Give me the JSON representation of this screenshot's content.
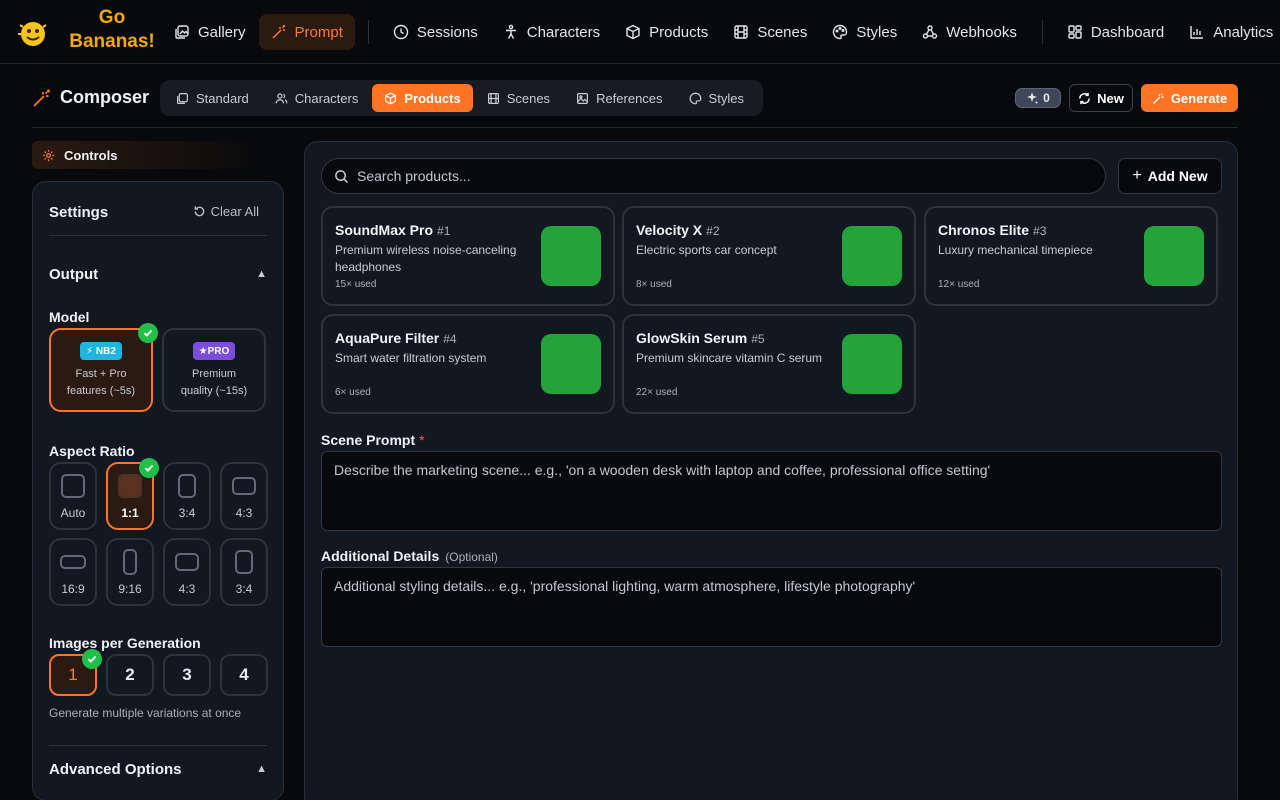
{
  "app": {
    "brand_line1": "Go",
    "brand_line2": "Bananas!",
    "accent_color": "#ff7324",
    "brand_color": "#f5a800"
  },
  "nav": {
    "items": [
      {
        "label": "Gallery",
        "icon": "gallery-icon"
      },
      {
        "label": "Prompt",
        "icon": "wand-icon",
        "active": true
      },
      {
        "label": "Sessions",
        "icon": "clock-icon"
      },
      {
        "label": "Characters",
        "icon": "person-icon"
      },
      {
        "label": "Products",
        "icon": "box-icon"
      },
      {
        "label": "Scenes",
        "icon": "film-icon"
      },
      {
        "label": "Styles",
        "icon": "palette-icon"
      },
      {
        "label": "Webhooks",
        "icon": "webhook-icon"
      },
      {
        "label": "Dashboard",
        "icon": "grid-icon"
      },
      {
        "label": "Analytics",
        "icon": "chart-icon"
      }
    ]
  },
  "composer": {
    "title": "Composer",
    "tabs": [
      {
        "label": "Standard"
      },
      {
        "label": "Characters"
      },
      {
        "label": "Products",
        "active": true
      },
      {
        "label": "Scenes"
      },
      {
        "label": "References"
      },
      {
        "label": "Styles"
      }
    ],
    "credits": "0",
    "new_label": "New",
    "generate_label": "Generate"
  },
  "controls": {
    "label": "Controls",
    "settings_title": "Settings",
    "clear_all": "Clear All",
    "output_title": "Output",
    "model_label": "Model",
    "models": [
      {
        "badge": "NB2",
        "line1": "Fast + Pro",
        "line2": "features (~5s)",
        "selected": true
      },
      {
        "badge": "PRO",
        "line1": "Premium",
        "line2": "quality (~15s)",
        "selected": false
      }
    ],
    "aspect_label": "Aspect Ratio",
    "aspect_ratios": [
      "Auto",
      "1:1",
      "3:4",
      "4:3",
      "16:9",
      "9:16",
      "4:3",
      "3:4"
    ],
    "aspect_selected": "1:1",
    "images_label": "Images per Generation",
    "images_options": [
      "1",
      "2",
      "3",
      "4"
    ],
    "images_selected": "1",
    "images_hint": "Generate multiple variations at once",
    "advanced_title": "Advanced Options"
  },
  "products": {
    "search_placeholder": "Search products...",
    "add_new": "Add New",
    "items": [
      {
        "name": "SoundMax Pro",
        "num": "#1",
        "desc": "Premium wireless noise-canceling headphones",
        "used": "15× used"
      },
      {
        "name": "Velocity X",
        "num": "#2",
        "desc": "Electric sports car concept",
        "used": "8× used"
      },
      {
        "name": "Chronos Elite",
        "num": "#3",
        "desc": "Luxury mechanical timepiece",
        "used": "12× used"
      },
      {
        "name": "AquaPure Filter",
        "num": "#4",
        "desc": "Smart water filtration system",
        "used": "6× used"
      },
      {
        "name": "GlowSkin Serum",
        "num": "#5",
        "desc": "Premium skincare vitamin C serum",
        "used": "22× used"
      }
    ],
    "thumb_color": "#24a33a"
  },
  "form": {
    "scene_label": "Scene Prompt",
    "scene_required": "*",
    "scene_placeholder": "Describe the marketing scene... e.g., 'on a wooden desk with laptop and coffee, professional office setting'",
    "details_label": "Additional Details",
    "details_optional": "(Optional)",
    "details_placeholder": "Additional styling details... e.g., 'professional lighting, warm atmosphere, lifestyle photography'"
  }
}
